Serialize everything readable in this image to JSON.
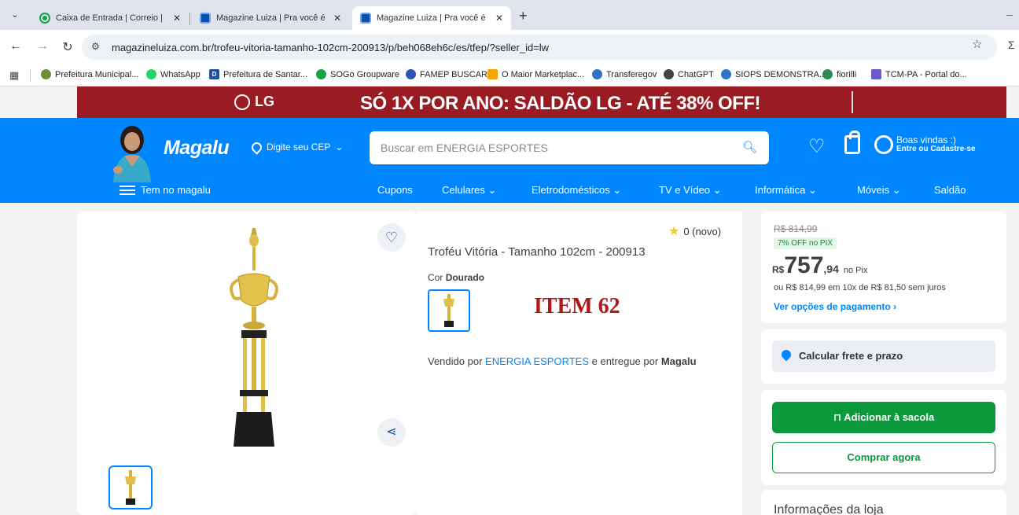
{
  "browser": {
    "tabs": [
      {
        "title": "Caixa de Entrada | Correio | SOGo",
        "icon": "sogo-icon"
      },
      {
        "title": "Magazine Luiza | Pra você é Magalu",
        "icon": "magalu-icon"
      },
      {
        "title": "Magazine Luiza | Pra você é Magalu",
        "icon": "magalu-icon",
        "active": true
      }
    ],
    "url": "magazineluiza.com.br/trofeu-vitoria-tamanho-102cm-200913/p/beh068eh6c/es/tfep/?seller_id=lw",
    "bookmarks": [
      "Prefeitura Municipal...",
      "WhatsApp",
      "Prefeitura de Santar...",
      "SOGo Groupware",
      "FAMEP BUSCAR",
      "O Maior Marketplac...",
      "Transferegov",
      "ChatGPT",
      "SIOPS DEMONSTRA...",
      "fiorilli",
      "TCM-PA - Portal do..."
    ]
  },
  "ad": {
    "brand": "LG",
    "text": "SÓ 1X POR ANO: SALDÃO LG - ATÉ 38% OFF!"
  },
  "header": {
    "logo": "Magalu",
    "cep_label": "Digite seu CEP",
    "search_placeholder": "Buscar em ENERGIA ESPORTES",
    "welcome": "Boas vindas :)",
    "login": "Entre ou Cadastre-se",
    "menu_label": "Tem no magalu",
    "categories": [
      "Cupons",
      "Celulares",
      "Eletrodomésticos",
      "TV e Vídeo",
      "Informática",
      "Móveis",
      "Saldão"
    ]
  },
  "product": {
    "rating_text": "0 (novo)",
    "title": "Troféu Vitória - Tamanho 102cm - 200913",
    "color_label": "Cor",
    "color_value": "Dourado",
    "item_label": "ITEM 62",
    "sold_by_prefix": "Vendido por",
    "seller": "ENERGIA ESPORTES",
    "delivered_by_prefix": "e entregue por",
    "delivered_by": "Magalu"
  },
  "price": {
    "old": "R$ 814,99",
    "discount_badge": "7% OFF no PIX",
    "currency": "R$",
    "integer": "757",
    "cents": ",94",
    "pix_label": "no Pix",
    "installments": "ou R$ 814,99 em 10x de R$ 81,50 sem juros",
    "payment_options": "Ver opções de pagamento"
  },
  "shipping": {
    "label": "Calcular frete e prazo"
  },
  "actions": {
    "add_to_bag": "Adicionar à sacola",
    "buy_now": "Comprar agora"
  },
  "store": {
    "title": "Informações da loja"
  },
  "colors": {
    "brand_blue": "#0086ff",
    "ad_red": "#9b1b22",
    "buy_green": "#0a9a3c"
  }
}
